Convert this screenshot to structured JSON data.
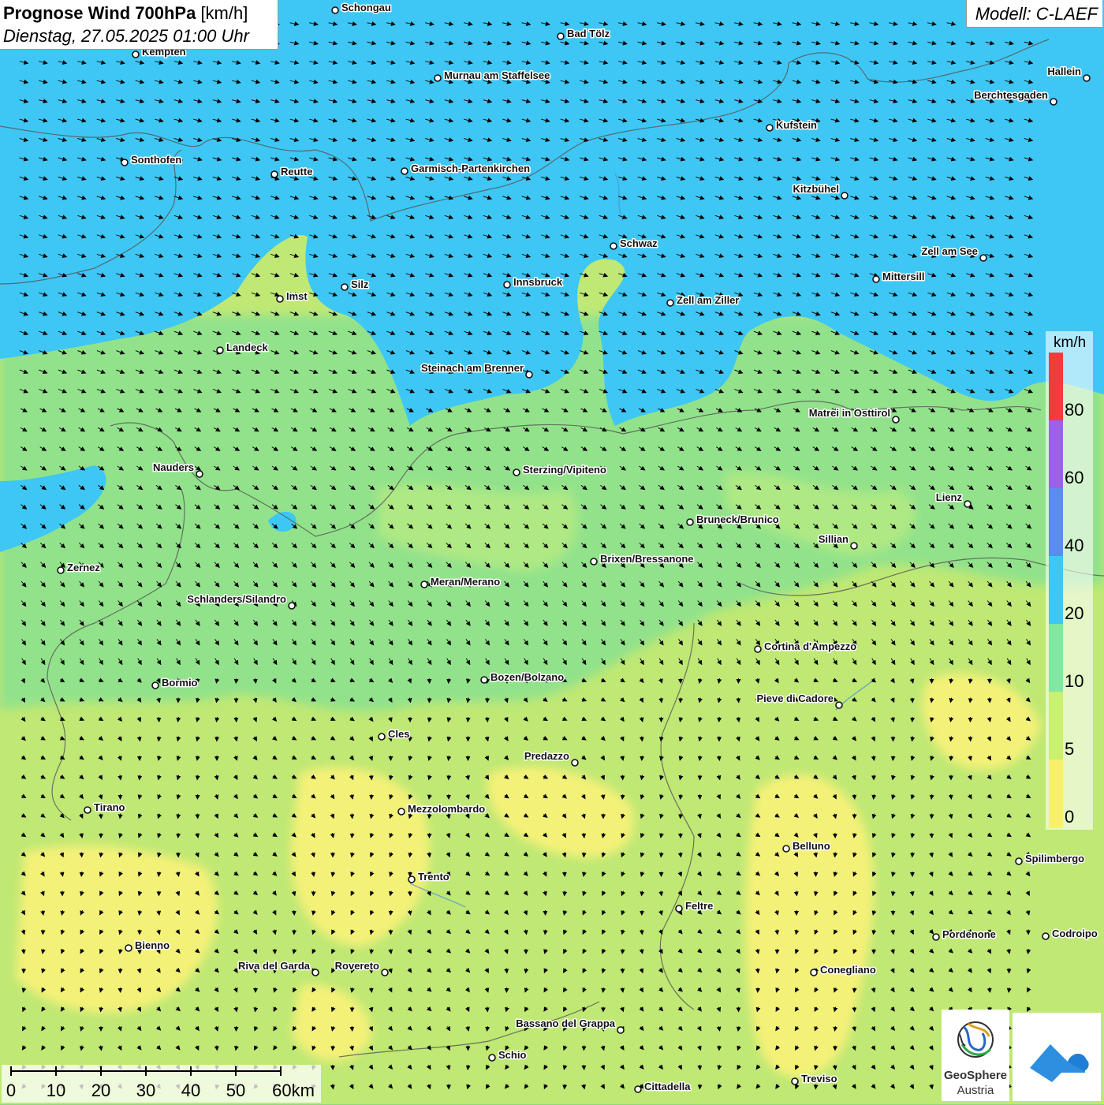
{
  "title": {
    "main": "Prognose Wind 700hPa",
    "unit": "[km/h]",
    "datetime": "Dienstag, 27.05.2025 01:00 Uhr"
  },
  "model": "Modell: C-LAEF",
  "colors": {
    "yellow": "#f6f075",
    "yellowgreen": "#c8ee6e",
    "green": "#8fe38a",
    "lightgreen": "#a6e68a",
    "blue": "#3ec7f4"
  },
  "legend": {
    "unit": "km/h",
    "labels": [
      "0",
      "5",
      "10",
      "20",
      "40",
      "60",
      "80"
    ],
    "band_colors": [
      "#f8f06a",
      "#c9f06e",
      "#7fe8a0",
      "#3ec7f4",
      "#5b8cf0",
      "#9a62ea",
      "#f23b3b"
    ]
  },
  "wind_direction": "north-westerly",
  "scale_bar": {
    "labels": [
      "0",
      "10",
      "20",
      "30",
      "40",
      "50",
      "60km"
    ]
  },
  "cities": [
    {
      "name": "Schongau",
      "label_side": "right"
    },
    {
      "name": "Bad Tölz",
      "label_side": "right"
    },
    {
      "name": "Kempten",
      "label_side": "right"
    },
    {
      "name": "Murnau am Staffelsee",
      "label_side": "right"
    },
    {
      "name": "Hallein",
      "label_side": "left"
    },
    {
      "name": "Berchtesgaden",
      "label_side": "left"
    },
    {
      "name": "Kufstein",
      "label_side": "right"
    },
    {
      "name": "Sonthofen",
      "label_side": "right"
    },
    {
      "name": "Reutte",
      "label_side": "right"
    },
    {
      "name": "Garmisch-Partenkirchen",
      "label_side": "right"
    },
    {
      "name": "Kitzbühel",
      "label_side": "left"
    },
    {
      "name": "Schwaz",
      "label_side": "right"
    },
    {
      "name": "Zell am See",
      "label_side": "left"
    },
    {
      "name": "Innsbruck",
      "label_side": "right"
    },
    {
      "name": "Silz",
      "label_side": "right"
    },
    {
      "name": "Imst",
      "label_side": "right"
    },
    {
      "name": "Mittersill",
      "label_side": "right"
    },
    {
      "name": "Zell am Ziller",
      "label_side": "right"
    },
    {
      "name": "Landeck",
      "label_side": "right"
    },
    {
      "name": "Steinach am Brenner",
      "label_side": "left"
    },
    {
      "name": "Matrei in Osttirol",
      "label_side": "left"
    },
    {
      "name": "Nauders",
      "label_side": "left"
    },
    {
      "name": "Sterzing/Vipiteno",
      "label_side": "right"
    },
    {
      "name": "Lienz",
      "label_side": "left"
    },
    {
      "name": "Bruneck/Brunico",
      "label_side": "right"
    },
    {
      "name": "Sillian",
      "label_side": "left"
    },
    {
      "name": "Brixen/Bressanone",
      "label_side": "right"
    },
    {
      "name": "Zernez",
      "label_side": "right"
    },
    {
      "name": "Meran/Merano",
      "label_side": "right"
    },
    {
      "name": "Schlanders/Silandro",
      "label_side": "left"
    },
    {
      "name": "Cortina d'Ampezzo",
      "label_side": "right"
    },
    {
      "name": "Bozen/Bolzano",
      "label_side": "right"
    },
    {
      "name": "Bormio",
      "label_side": "right"
    },
    {
      "name": "Pieve di Cadore",
      "label_side": "left"
    },
    {
      "name": "Cles",
      "label_side": "right"
    },
    {
      "name": "Predazzo",
      "label_side": "left"
    },
    {
      "name": "Tirano",
      "label_side": "right"
    },
    {
      "name": "Mezzolombardo",
      "label_side": "right"
    },
    {
      "name": "Belluno",
      "label_side": "right"
    },
    {
      "name": "Spilimbergo",
      "label_side": "right"
    },
    {
      "name": "Trento",
      "label_side": "right"
    },
    {
      "name": "Feltre",
      "label_side": "right"
    },
    {
      "name": "Pordenone",
      "label_side": "right"
    },
    {
      "name": "Codroipo",
      "label_side": "right"
    },
    {
      "name": "Bienno",
      "label_side": "right"
    },
    {
      "name": "Riva del Garda",
      "label_side": "left"
    },
    {
      "name": "Rovereto",
      "label_side": "left"
    },
    {
      "name": "Conegliano",
      "label_side": "right"
    },
    {
      "name": "Bassano del Grappa",
      "label_side": "left"
    },
    {
      "name": "Schio",
      "label_side": "right"
    },
    {
      "name": "Treviso",
      "label_side": "right"
    },
    {
      "name": "Cittadella",
      "label_side": "right"
    }
  ],
  "logos": {
    "geosphere_name": "GeoSphere",
    "geosphere_country": "Austria"
  }
}
